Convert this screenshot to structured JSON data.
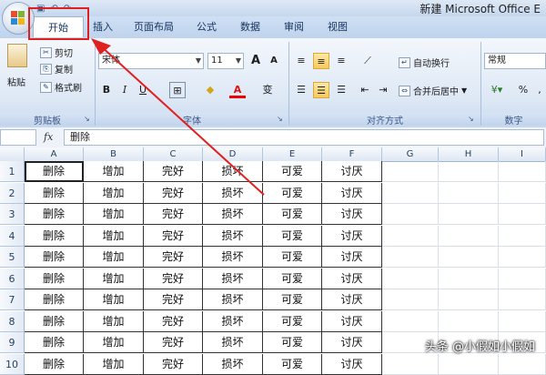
{
  "window": {
    "title": "新建 Microsoft Office E"
  },
  "quick_access": [
    "save-icon",
    "undo-icon",
    "redo-icon"
  ],
  "tabs": [
    {
      "id": "home",
      "label": "开始",
      "active": true
    },
    {
      "id": "insert",
      "label": "插入"
    },
    {
      "id": "page_layout",
      "label": "页面布局"
    },
    {
      "id": "formulas",
      "label": "公式"
    },
    {
      "id": "data",
      "label": "数据"
    },
    {
      "id": "review",
      "label": "审阅"
    },
    {
      "id": "view",
      "label": "视图"
    }
  ],
  "ribbon": {
    "clipboard": {
      "paste": "粘贴",
      "cut": "剪切",
      "copy": "复制",
      "format_painter": "格式刷",
      "group_label": "剪贴板"
    },
    "font": {
      "font_name": "宋体",
      "font_size": "11",
      "grow": "A",
      "shrink": "A",
      "bold": "B",
      "italic": "I",
      "underline": "U",
      "font_color_glyph": "A",
      "phonetic": "变",
      "group_label": "字体"
    },
    "alignment": {
      "wrap_text": "自动换行",
      "merge_center": "合并后居中",
      "group_label": "对齐方式"
    },
    "number": {
      "format": "常规",
      "percent": "%",
      "comma": ",",
      "group_label": "数字"
    }
  },
  "formula_bar": {
    "fx": "fx",
    "content": "删除"
  },
  "sheet": {
    "columns": [
      "A",
      "B",
      "C",
      "D",
      "E",
      "F",
      "G",
      "H",
      "I"
    ],
    "row_numbers": [
      "1",
      "2",
      "3",
      "4",
      "5",
      "6",
      "7",
      "8",
      "9",
      "10"
    ],
    "row_values": [
      "删除",
      "增加",
      "完好",
      "损坏",
      "可爱",
      "讨厌"
    ],
    "row_count_visible": 10
  },
  "colors": {
    "annotation_red": "#e0201f",
    "accent_selected": "#f8c85c",
    "ribbon_blue": "#c7d8ee"
  },
  "watermark": "头条 @小假如小假如"
}
